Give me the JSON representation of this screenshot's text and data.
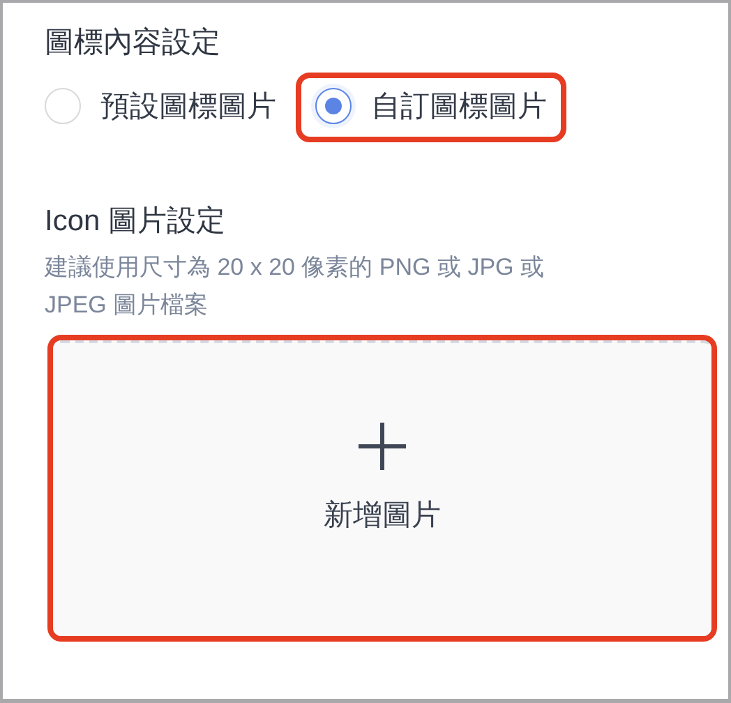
{
  "icon_content": {
    "title": "圖標內容設定",
    "options": [
      {
        "label": "預設圖標圖片",
        "selected": false,
        "highlighted": false
      },
      {
        "label": "自訂圖標圖片",
        "selected": true,
        "highlighted": true
      }
    ]
  },
  "icon_image": {
    "title": "Icon 圖片設定",
    "hint": "建議使用尺寸為 20 x 20 像素的 PNG 或 JPG 或 JPEG 圖片檔案",
    "upload": {
      "label": "新增圖片",
      "highlighted": true
    }
  }
}
